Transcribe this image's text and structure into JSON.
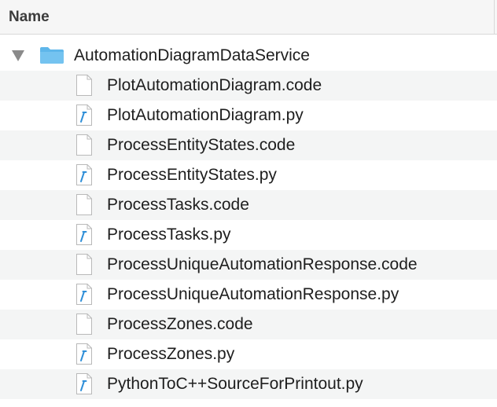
{
  "header": {
    "name_label": "Name"
  },
  "folder": {
    "name": "AutomationDiagramDataService",
    "expanded": true
  },
  "files": [
    {
      "name": "PlotAutomationDiagram.code",
      "icon": "document-icon"
    },
    {
      "name": "PlotAutomationDiagram.py",
      "icon": "python-file-icon"
    },
    {
      "name": "ProcessEntityStates.code",
      "icon": "document-icon"
    },
    {
      "name": "ProcessEntityStates.py",
      "icon": "python-file-icon"
    },
    {
      "name": "ProcessTasks.code",
      "icon": "document-icon"
    },
    {
      "name": "ProcessTasks.py",
      "icon": "python-file-icon"
    },
    {
      "name": "ProcessUniqueAutomationResponse.code",
      "icon": "document-icon"
    },
    {
      "name": "ProcessUniqueAutomationResponse.py",
      "icon": "python-file-icon"
    },
    {
      "name": "ProcessZones.code",
      "icon": "document-icon"
    },
    {
      "name": "ProcessZones.py",
      "icon": "python-file-icon"
    },
    {
      "name": "PythonToC++SourceForPrintout.py",
      "icon": "python-file-icon"
    }
  ],
  "colors": {
    "folder": "#5eb6ea",
    "python_mark": "#2f8fd8",
    "row_alt": "#f4f5f5"
  }
}
